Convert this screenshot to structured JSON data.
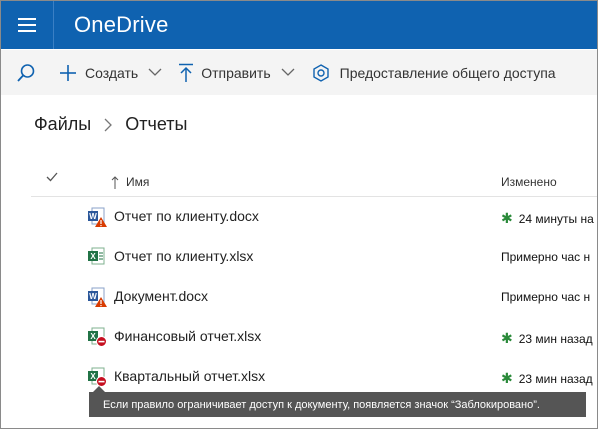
{
  "app": {
    "title": "OneDrive"
  },
  "command_bar": {
    "create_label": "Создать",
    "upload_label": "Отправить",
    "share_label": "Предоставление общего доступа"
  },
  "breadcrumb": {
    "root": "Файлы",
    "current": "Отчеты"
  },
  "list": {
    "columns": {
      "name": "Имя",
      "modified": "Изменено"
    },
    "rows": [
      {
        "name": "Отчет по клиенту.docx",
        "modified": "24 минуты на",
        "icon": "word-warning-icon",
        "new": true
      },
      {
        "name": "Отчет по клиенту.xlsx",
        "modified": "Примерно час н",
        "icon": "excel-icon",
        "new": false
      },
      {
        "name": "Документ.docx",
        "modified": "Примерно час н",
        "icon": "word-warning-icon",
        "new": false
      },
      {
        "name": "Финансовый отчет.xlsx",
        "modified": "23 мин назад",
        "icon": "excel-blocked-icon",
        "new": true
      },
      {
        "name": "Квартальный отчет.xlsx",
        "modified": "23 мин назад",
        "icon": "excel-blocked-icon",
        "new": true
      }
    ]
  },
  "tooltip": {
    "text": "Если правило ограничивает доступ к документу, появляется значок “Заблокировано”."
  },
  "colors": {
    "suitebar": "#0f62b0",
    "accent": "#0f62b0",
    "word": "#2b579a",
    "excel": "#217346",
    "warning": "#d83b01",
    "blocked": "#c50f1f",
    "new_star": "#2a8a3a"
  }
}
